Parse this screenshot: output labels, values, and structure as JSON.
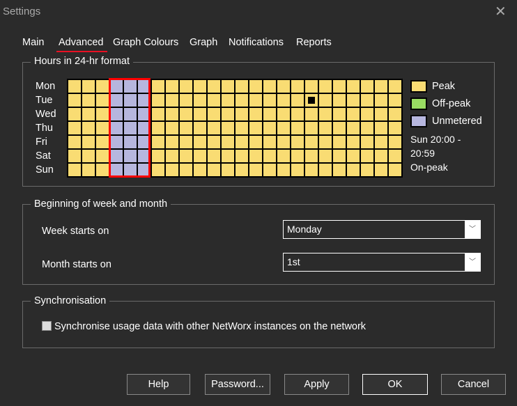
{
  "window": {
    "title": "Settings",
    "close_icon": "close-icon"
  },
  "tabs": [
    {
      "label": "Main"
    },
    {
      "label": "Advanced",
      "active": true
    },
    {
      "label": "Graph Colours"
    },
    {
      "label": "Graph"
    },
    {
      "label": "Notifications"
    },
    {
      "label": "Reports"
    }
  ],
  "hours": {
    "title": "Hours in 24-hr format",
    "days": [
      "Mon",
      "Tue",
      "Wed",
      "Thu",
      "Fri",
      "Sat",
      "Sun"
    ],
    "colors": {
      "peak": "#f9dc73",
      "off-peak": "#99dc62",
      "unmetered": "#b6b6de",
      "selection": "#ff0000",
      "tab_underline": "#e81123"
    },
    "unmetered_hours": [
      3,
      4,
      5
    ],
    "selected_hours": [
      3,
      4,
      5
    ],
    "marked_cell": {
      "day": "Tue",
      "hour": 17
    },
    "legend": [
      {
        "key": "peak",
        "label": "Peak"
      },
      {
        "key": "off-peak",
        "label": "Off-peak"
      },
      {
        "key": "unmetered",
        "label": "Unmetered"
      }
    ],
    "info_line1": "Sun 20:00 -",
    "info_line2": "20:59",
    "info_line3": "On-peak"
  },
  "week_month": {
    "title": "Beginning of week and month",
    "week_label": "Week starts on",
    "week_value": "Monday",
    "month_label": "Month starts on",
    "month_value": "1st"
  },
  "sync": {
    "title": "Synchronisation",
    "checkbox_label": "Synchronise usage data with other NetWorx instances on the network",
    "checked": false
  },
  "buttons": {
    "help": "Help",
    "password": "Password...",
    "apply": "Apply",
    "ok": "OK",
    "cancel": "Cancel"
  }
}
